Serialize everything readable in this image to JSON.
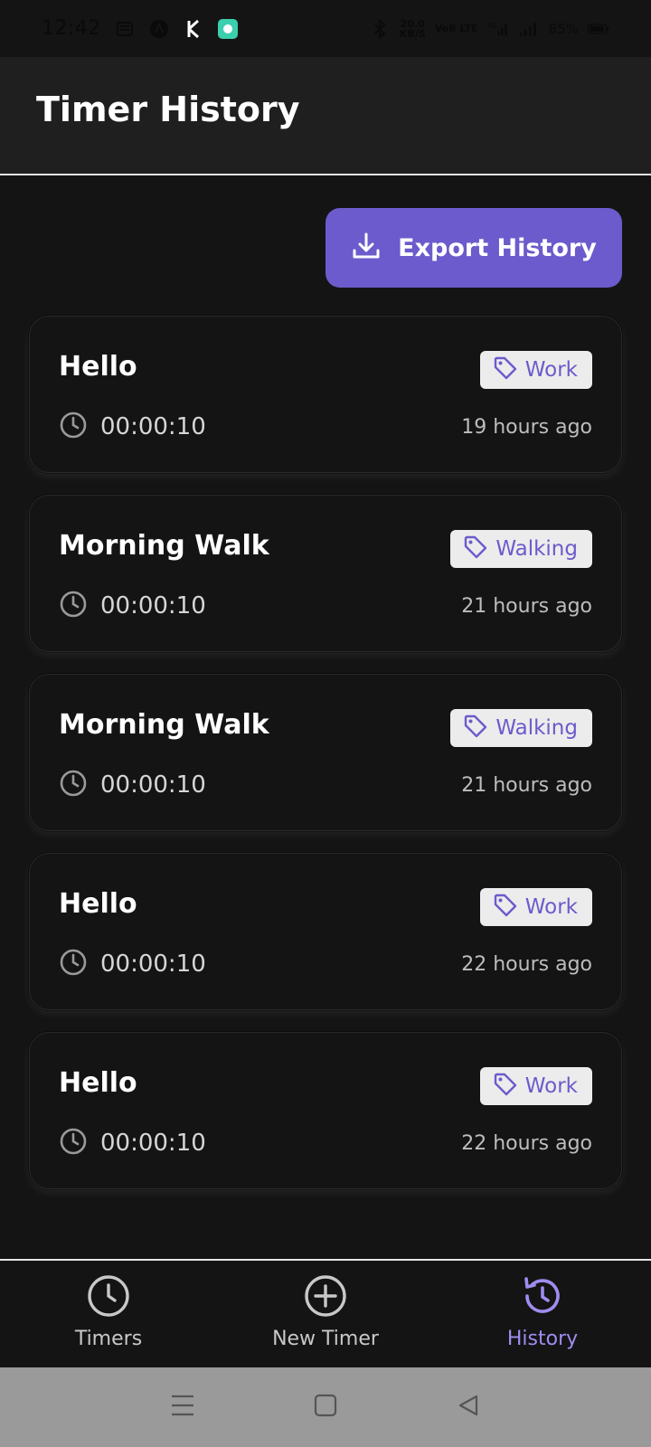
{
  "status_bar": {
    "time": "12:42",
    "net_speed_top": "20.0",
    "net_speed_bottom": "KB/S",
    "volte": "VoB LTE",
    "network": "4G",
    "battery": "85%"
  },
  "header": {
    "title": "Timer History"
  },
  "export": {
    "label": "Export History",
    "icon": "download-icon"
  },
  "colors": {
    "accent": "#6b5bcc",
    "nav_active": "#a08cf0",
    "background": "#141414"
  },
  "history": [
    {
      "title": "Hello",
      "tag": "Work",
      "duration": "00:00:10",
      "time_ago": "19 hours ago"
    },
    {
      "title": "Morning Walk",
      "tag": "Walking",
      "duration": "00:00:10",
      "time_ago": "21 hours ago"
    },
    {
      "title": "Morning Walk",
      "tag": "Walking",
      "duration": "00:00:10",
      "time_ago": "21 hours ago"
    },
    {
      "title": "Hello",
      "tag": "Work",
      "duration": "00:00:10",
      "time_ago": "22 hours ago"
    },
    {
      "title": "Hello",
      "tag": "Work",
      "duration": "00:00:10",
      "time_ago": "22 hours ago"
    }
  ],
  "nav": [
    {
      "label": "Timers",
      "icon": "clock-icon",
      "active": false
    },
    {
      "label": "New Timer",
      "icon": "plus-circle-icon",
      "active": false
    },
    {
      "label": "History",
      "icon": "history-icon",
      "active": true
    }
  ]
}
